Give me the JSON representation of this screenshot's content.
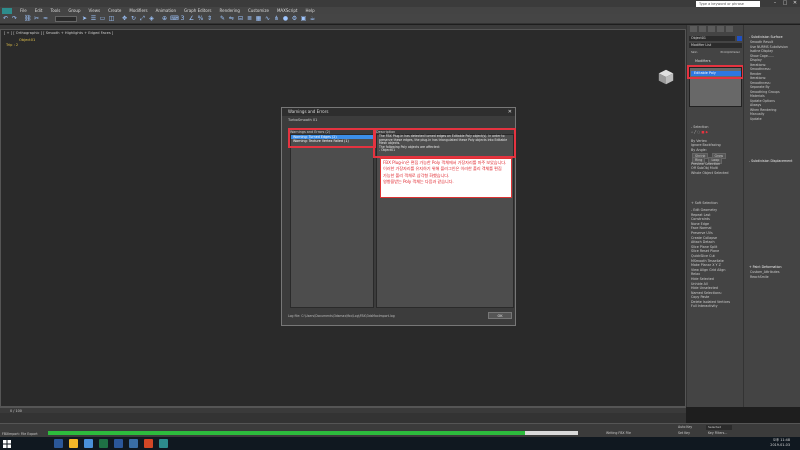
{
  "window": {
    "search_placeholder": "Type a keyword or phrase",
    "min": "–",
    "max": "□",
    "close": "✕"
  },
  "menu": [
    "File",
    "Edit",
    "Tools",
    "Group",
    "Views",
    "Create",
    "Modifiers",
    "Animation",
    "Graph Editors",
    "Rendering",
    "Customize",
    "MAXScript",
    "Help"
  ],
  "viewport": {
    "label": "[ + ] [ Orthographic ] [ Smooth + Highlights + Edged Faces ]",
    "object_tag": "Object01",
    "trip_tag": "Trip : 2"
  },
  "dialog": {
    "title": "Warnings and Errors",
    "close": "✕",
    "subtitle": "TurboSmooth 01",
    "warnings_header": "Warnings and Errors (2)",
    "description_header": "Description",
    "warnings": [
      {
        "text": "Warning: Turned Edges (2)",
        "selected": true
      },
      {
        "text": "Warning: Texture Vertex Failed (1)",
        "selected": false
      }
    ],
    "description_lines": [
      "The FBX Plug-in has detected turned edges on Editable Poly object(s). In order to",
      "preserve these edges, the plug-in has triangulated these Poly objects into Editable",
      "Mesh objects.",
      "The following Poly objects are affected:",
      "- Object01"
    ],
    "log_path": "Log file: C:\\Users\\Documents\\3dsmax\\fbx\\Log\\FBX\\3dsMaxImport.log",
    "ok": "OK"
  },
  "annotation": [
    "FBX Plug-in은 편집 가능한 Poly 객체에서 가장자리를 마주 보았습니다.",
    "이러한 가장자리를 유지하기 위해 플러그인은 이러한 폴리 객체를 편집",
    "가능한 폴리 객체로 삼각형 화했습니다.",
    "영향을받는 Poly 객체는 다음과 같습니다."
  ],
  "cmdpanel": {
    "object_name": "Object01",
    "modifier_list": "Modifier List",
    "buttons": [
      "Skin",
      "ProOptimizer"
    ],
    "stack_label": "Modifiers",
    "stack_item": "Editable Poly",
    "selection": {
      "title": "- Selection",
      "by_vertex": "By Vertex",
      "ignore_backfacing": "Ignore Backfacing",
      "by_angle": "By Angle:",
      "shrink": "Shrink",
      "grow": "Grow",
      "ring": "Ring",
      "loop": "Loop",
      "preview_selection": "Preview Selection",
      "off": "Off",
      "subobj": "SubObj",
      "multi": "Multi",
      "whole_object": "Whole Object Selected"
    },
    "soft_selection": "+ Soft Selection",
    "edit_geometry": {
      "title": "- Edit Geometry",
      "repeat_last": "Repeat Last",
      "constraints": "Constraints",
      "none": "None",
      "edge": "Edge",
      "face": "Face",
      "normal": "Normal",
      "preserve_uvs": "Preserve UVs",
      "create": "Create",
      "collapse": "Collapse",
      "attach": "Attach",
      "detach": "Detach",
      "slice_plane": "Slice Plane",
      "split": "Split",
      "slice": "Slice",
      "reset_plane": "Reset Plane",
      "quickslice": "QuickSlice",
      "cut": "Cut",
      "msmooth": "MSmooth",
      "tessellate": "Tessellate",
      "make_planar": "Make Planar",
      "x": "X",
      "y": "Y",
      "z": "Z",
      "view_align": "View Align",
      "grid_align": "Grid Align",
      "relax": "Relax",
      "hide_selected": "Hide Selected",
      "unhide_all": "Unhide All",
      "hide_unselected": "Hide Unselected",
      "named_selections": "Named Selections:",
      "copy": "Copy",
      "paste": "Paste",
      "delete_isolated": "Delete Isolated Vertices",
      "full_interactivity": "Full Interactivity"
    }
  },
  "proppanel": {
    "subdivision_surface": "- Subdivision Surface",
    "smooth_result": "Smooth Result",
    "use_nurms": "Use NURMS Subdivision",
    "isoline_display": "Isoline Display",
    "show_cage": "Show Cage......",
    "display": "Display",
    "iterations": "Iterations:",
    "smoothness": "Smoothness:",
    "render": "Render",
    "separate_by": "Separate By",
    "smoothing_groups": "Smoothing Groups",
    "materials": "Materials",
    "update_options": "Update Options",
    "always": "Always",
    "when_rendering": "When Rendering",
    "manually": "Manually",
    "update": "Update",
    "subdivision_displacement": "- Subdivision Displacement",
    "paint_deformation": "+ Paint Deformation",
    "custom_attributes": "Custom_Attributes",
    "reachsmile": "ReachSmile"
  },
  "timeline": {
    "label": "0 / 100"
  },
  "status": {
    "left": "FBXImport: File Export",
    "progress": 0.9,
    "mid": "Writing FBX File",
    "auto_key": "Auto Key",
    "set_key": "Set Key",
    "selected": "Selected",
    "key_filters": "Key Filters..."
  },
  "taskbar": {
    "time": "오후 11:48",
    "date": "2019-01-03"
  },
  "colors": {
    "highlight": "#e53340",
    "selection_blue": "#3c8ee8",
    "progress_green": "#2dbb3d"
  }
}
